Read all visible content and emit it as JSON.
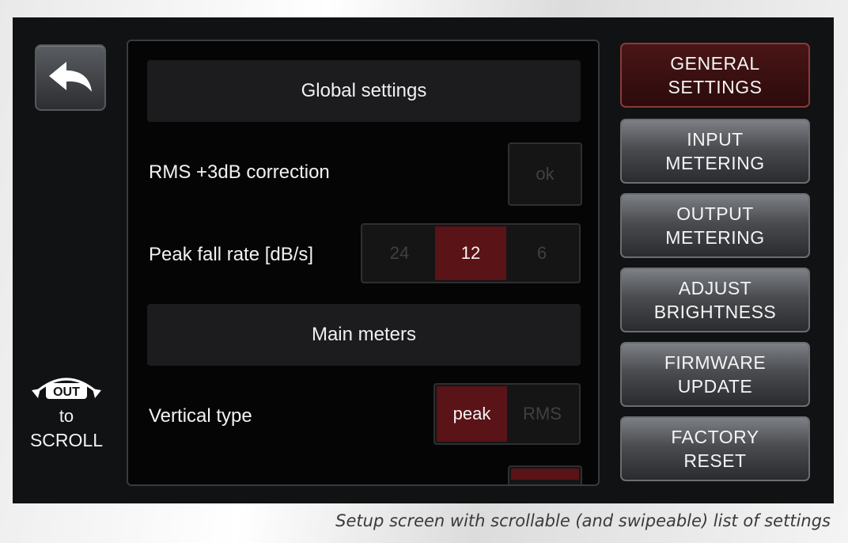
{
  "panel": {
    "global_header": "Global settings",
    "rms_label": "RMS +3dB correction",
    "rms_button": "ok",
    "peak_label": "Peak fall rate [dB/s]",
    "peak_options": [
      "24",
      "12",
      "6"
    ],
    "peak_selected": "12",
    "main_header": "Main meters",
    "vertical_label": "Vertical type",
    "vertical_options": [
      "peak",
      "RMS"
    ],
    "vertical_selected": "peak"
  },
  "scroll_hint": {
    "knob_text": "OUT",
    "to": "to",
    "scroll": "SCROLL"
  },
  "menu": [
    {
      "label": "GENERAL\nSETTINGS",
      "active": true
    },
    {
      "label": "INPUT\nMETERING",
      "active": false
    },
    {
      "label": "OUTPUT\nMETERING",
      "active": false
    },
    {
      "label": "ADJUST\nBRIGHTNESS",
      "active": false
    },
    {
      "label": "FIRMWARE\nUPDATE",
      "active": false
    },
    {
      "label": "FACTORY\nRESET",
      "active": false
    }
  ],
  "caption": "Setup screen with scrollable (and swipeable) list of settings",
  "colors": {
    "accent": "#5a1316",
    "background": "#111214"
  },
  "icons": {
    "back": "back-arrow-icon",
    "knob": "rotary-knob-icon"
  }
}
